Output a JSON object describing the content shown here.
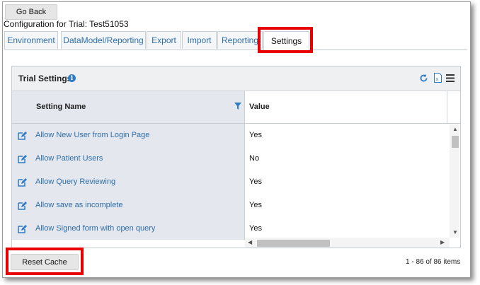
{
  "go_back_label": "Go Back",
  "config_title": "Configuration for Trial: Test51053",
  "tabs": [
    {
      "label": "Environment"
    },
    {
      "label": "DataModel/Reporting"
    },
    {
      "label": "Export"
    },
    {
      "label": "Import"
    },
    {
      "label": "Reporting"
    },
    {
      "label": "Settings",
      "active": true
    }
  ],
  "panel": {
    "title": "Trial Settings",
    "info_icon": "info-icon",
    "header_icons": [
      "refresh-icon",
      "excel-export-icon",
      "menu-icon"
    ]
  },
  "grid": {
    "columns": [
      "Setting Name",
      "Value"
    ],
    "rows": [
      {
        "name": "Allow New User from Login Page",
        "value": "Yes"
      },
      {
        "name": "Allow Patient Users",
        "value": "No"
      },
      {
        "name": "Allow Query Reviewing",
        "value": "Yes"
      },
      {
        "name": "Allow save as incomplete",
        "value": "Yes"
      },
      {
        "name": "Allow Signed form with open query",
        "value": "Yes"
      }
    ]
  },
  "reset_cache_label": "Reset Cache",
  "pager_text": "1 - 86 of 86 items",
  "colors": {
    "highlight": "#e80000",
    "link": "#2f6ea7",
    "accent_icon": "#2f7cc4"
  }
}
